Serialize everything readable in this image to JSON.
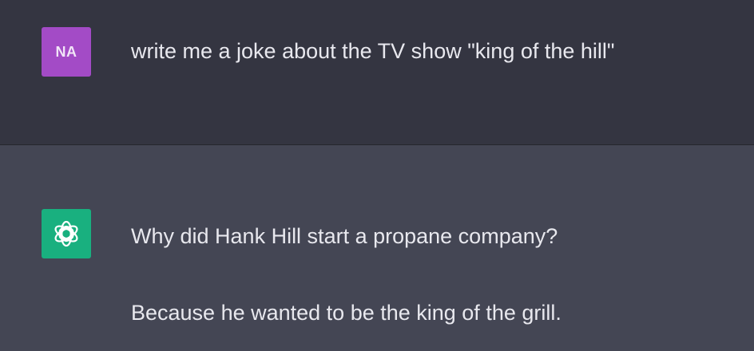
{
  "colors": {
    "user_row_bg": "#343541",
    "assistant_row_bg": "#444654",
    "user_avatar_bg": "#a34bc6",
    "assistant_avatar_bg": "#19b07f",
    "text": "#e8e8ee"
  },
  "user_message": {
    "avatar_initials": "NA",
    "text": "write me a joke about the TV show \"king of the hill\""
  },
  "assistant_message": {
    "avatar_icon": "openai-logo-icon",
    "lines": [
      "Why did Hank Hill start a propane company?",
      "Because he wanted to be the king of the grill."
    ]
  }
}
